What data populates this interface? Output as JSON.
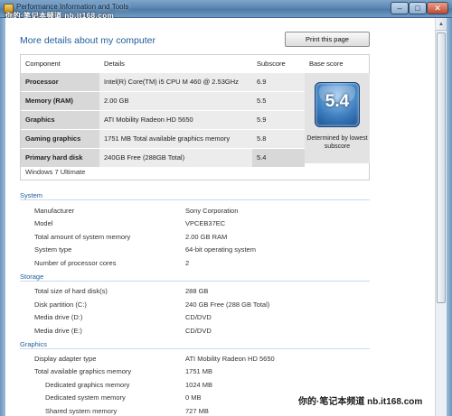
{
  "window": {
    "title": "Performance Information and Tools",
    "watermark": "你的·笔记本频道 nb.it168.com",
    "min_symbol": "–",
    "max_symbol": "□",
    "close_symbol": "✕"
  },
  "heading": "More details about my computer",
  "print_button": "Print this page",
  "score_table": {
    "headers": {
      "component": "Component",
      "details": "Details",
      "subscore": "Subscore",
      "base": "Base score"
    },
    "rows": [
      {
        "component": "Processor",
        "details": "Intel(R) Core(TM) i5 CPU M 460 @ 2.53GHz",
        "subscore": "6.9"
      },
      {
        "component": "Memory (RAM)",
        "details": "2.00 GB",
        "subscore": "5.5"
      },
      {
        "component": "Graphics",
        "details": "ATI Mobility Radeon HD 5650",
        "subscore": "5.9"
      },
      {
        "component": "Gaming graphics",
        "details": "1751 MB Total available graphics memory",
        "subscore": "5.8"
      },
      {
        "component": "Primary hard disk",
        "details": "240GB Free (288GB Total)",
        "subscore": "5.4"
      }
    ],
    "base_score": "5.4",
    "base_caption": "Determined by lowest subscore",
    "os": "Windows 7 Ultimate"
  },
  "system": {
    "title": "System",
    "items": [
      {
        "label": "Manufacturer",
        "value": "Sony Corporation"
      },
      {
        "label": "Model",
        "value": "VPCEB37EC"
      },
      {
        "label": "Total amount of system memory",
        "value": "2.00 GB RAM"
      },
      {
        "label": "System type",
        "value": "64-bit operating system"
      },
      {
        "label": "Number of processor cores",
        "value": "2"
      }
    ]
  },
  "storage": {
    "title": "Storage",
    "items": [
      {
        "label": "Total size of hard disk(s)",
        "value": "288 GB"
      },
      {
        "label": "Disk partition (C:)",
        "value": "240 GB Free (288 GB Total)"
      },
      {
        "label": "Media drive (D:)",
        "value": "CD/DVD"
      },
      {
        "label": "Media drive (E:)",
        "value": "CD/DVD"
      }
    ]
  },
  "graphics": {
    "title": "Graphics",
    "items": [
      {
        "label": "Display adapter type",
        "value": "ATI Mobility Radeon HD 5650"
      },
      {
        "label": "Total available graphics memory",
        "value": "1751 MB"
      },
      {
        "label": "Dedicated graphics memory",
        "value": "1024 MB"
      },
      {
        "label": "Dedicated system memory",
        "value": "0 MB"
      },
      {
        "label": "Shared system memory",
        "value": "727 MB"
      }
    ]
  },
  "site_mark": {
    "prefix": "你的·笔记本频道",
    "site": "nb.it168.com"
  },
  "colors": {
    "accent": "#1f5c99",
    "badge": "#3e7fc0"
  }
}
